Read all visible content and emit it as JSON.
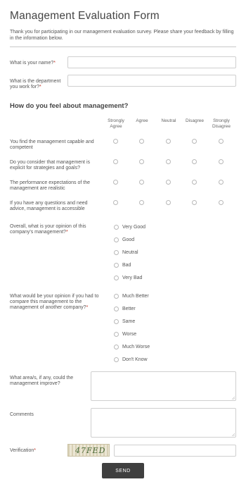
{
  "form": {
    "title": "Management Evaluation Form",
    "intro": "Thank you for participating in our management evaluation survey. Please share your feedback by filling in the information below."
  },
  "fields": {
    "name_label": "What is your name?",
    "department_label": "What is the department you work for?",
    "required_mark": "*"
  },
  "section": {
    "heading": "How do you feel about management?"
  },
  "matrix": {
    "columns": [
      "Strongly Agree",
      "Agree",
      "Neutral",
      "Disagree",
      "Strongly Disagree"
    ],
    "rows": [
      "You find the management capable and competent",
      "Do you consider that management is explicit for strategies and goals?",
      "The performance expectations of the management are realistic",
      "If you have any questions and need advice, management is accessible"
    ]
  },
  "opinion": {
    "label": "Overall, what is your opinion of this company's management?",
    "options": [
      "Very Good",
      "Good",
      "Neutral",
      "Bad",
      "Very Bad"
    ]
  },
  "comparison": {
    "label": "What would be your opinion if you had to compare this management to the management of another company?",
    "options": [
      "Much Better",
      "Better",
      "Same",
      "Worse",
      "Much Worse",
      "Don't Know"
    ]
  },
  "improve": {
    "label": "What area/s, if any, could the management improve?"
  },
  "comments": {
    "label": "Comments"
  },
  "verification": {
    "label": "Verification",
    "captcha_text": "47FED"
  },
  "submit": {
    "label": "SEND"
  }
}
